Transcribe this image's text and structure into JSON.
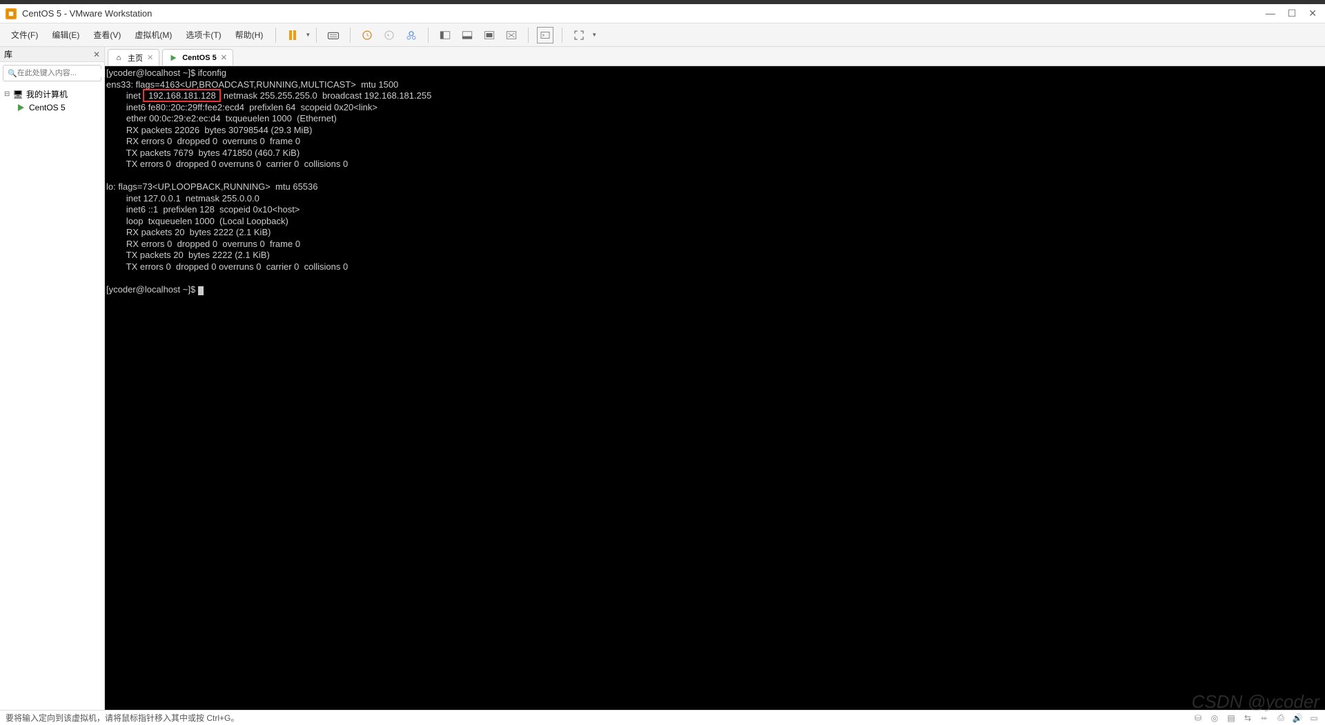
{
  "window": {
    "title": "CentOS 5 - VMware Workstation"
  },
  "menu": {
    "file": "文件(F)",
    "edit": "编辑(E)",
    "view": "查看(V)",
    "vm": "虚拟机(M)",
    "tabs": "选项卡(T)",
    "help": "帮助(H)"
  },
  "sidebar": {
    "title": "库",
    "search_placeholder": "在此处键入内容...",
    "root": "我的计算机",
    "item1": "CentOS 5"
  },
  "tabs": {
    "home": "主页",
    "centos": "CentOS 5"
  },
  "terminal": {
    "prompt1": "[ycoder@localhost ~]$ ",
    "cmd1": "ifconfig",
    "line1": "ens33: flags=4163<UP,BROADCAST,RUNNING,MULTICAST>  mtu 1500",
    "line2a": "        inet ",
    "ip_highlight": " 192.168.181.128 ",
    "line2b": " netmask 255.255.255.0  broadcast 192.168.181.255",
    "line3": "        inet6 fe80::20c:29ff:fee2:ecd4  prefixlen 64  scopeid 0x20<link>",
    "line4": "        ether 00:0c:29:e2:ec:d4  txqueuelen 1000  (Ethernet)",
    "line5": "        RX packets 22026  bytes 30798544 (29.3 MiB)",
    "line6": "        RX errors 0  dropped 0  overruns 0  frame 0",
    "line7": "        TX packets 7679  bytes 471850 (460.7 KiB)",
    "line8": "        TX errors 0  dropped 0 overruns 0  carrier 0  collisions 0",
    "line9": "",
    "line10": "lo: flags=73<UP,LOOPBACK,RUNNING>  mtu 65536",
    "line11": "        inet 127.0.0.1  netmask 255.0.0.0",
    "line12": "        inet6 ::1  prefixlen 128  scopeid 0x10<host>",
    "line13": "        loop  txqueuelen 1000  (Local Loopback)",
    "line14": "        RX packets 20  bytes 2222 (2.1 KiB)",
    "line15": "        RX errors 0  dropped 0  overruns 0  frame 0",
    "line16": "        TX packets 20  bytes 2222 (2.1 KiB)",
    "line17": "        TX errors 0  dropped 0 overruns 0  carrier 0  collisions 0",
    "line18": "",
    "prompt2": "[ycoder@localhost ~]$ "
  },
  "status": {
    "hint": "要将输入定向到该虚拟机，请将鼠标指针移入其中或按 Ctrl+G。"
  },
  "watermark": "CSDN @ycoder"
}
